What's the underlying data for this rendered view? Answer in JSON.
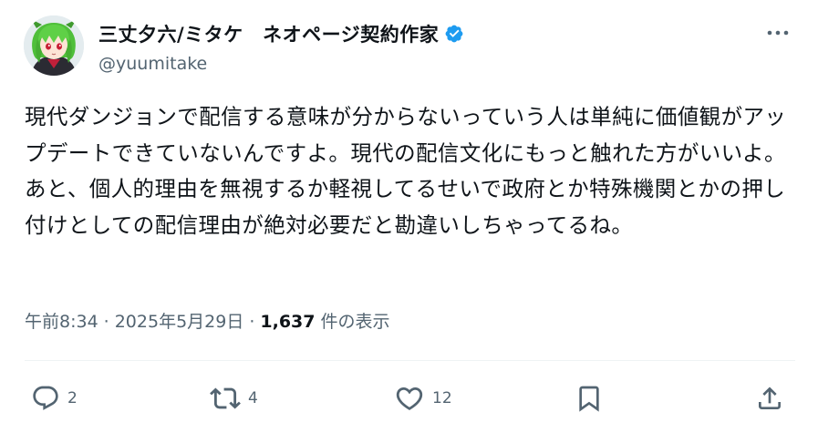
{
  "author": {
    "display_name": "三丈夕六/ミタケ　ネオページ契約作家",
    "handle": "@yuumitake",
    "verified_icon": "verified-badge-icon",
    "avatar": "anime-avatar-green-hair"
  },
  "tweet": {
    "text": "現代ダンジョンで配信する意味が分からないっていう人は単純に価値観がアップデートできていないんですよ。現代の配信文化にもっと触れた方がいいよ。あと、個人的理由を無視するか軽視してるせいで政府とか特殊機関とかの押し付けとしての配信理由が絶対必要だと勘違いしちゃってるね。"
  },
  "meta": {
    "time": "午前8:34",
    "separator": "·",
    "date": "2025年5月29日",
    "views_count": "1,637",
    "views_label": "件の表示"
  },
  "actions": {
    "reply_count": "2",
    "repost_count": "4",
    "like_count": "12"
  },
  "colors": {
    "text": "#0f1419",
    "secondary": "#536471",
    "verified": "#1d9bf0",
    "divider": "#eff3f4"
  }
}
